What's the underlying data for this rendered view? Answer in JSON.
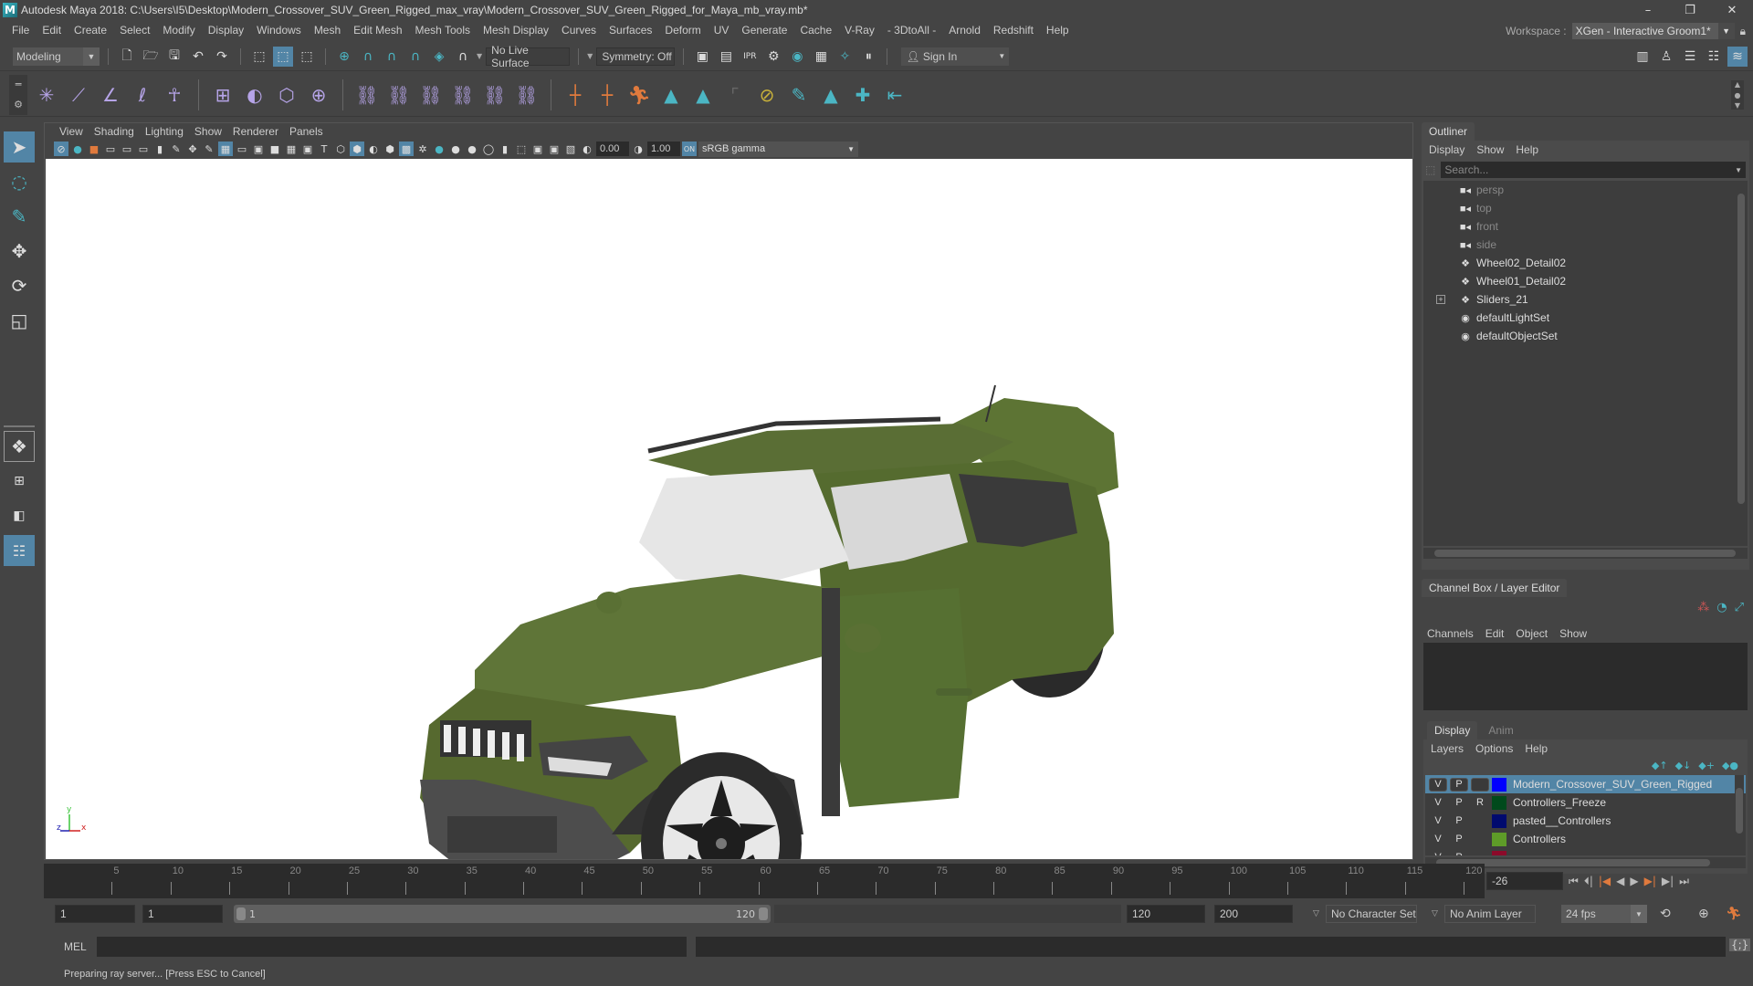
{
  "window": {
    "title": "Autodesk Maya 2018: C:\\Users\\I5\\Desktop\\Modern_Crossover_SUV_Green_Rigged_max_vray\\Modern_Crossover_SUV_Green_Rigged_for_Maya_mb_vray.mb*",
    "minimize": "–",
    "maximize": "❐",
    "close": "✕"
  },
  "menubar": {
    "items": [
      "File",
      "Edit",
      "Create",
      "Select",
      "Modify",
      "Display",
      "Windows",
      "Mesh",
      "Edit Mesh",
      "Mesh Tools",
      "Mesh Display",
      "Curves",
      "Surfaces",
      "Deform",
      "UV",
      "Generate",
      "Cache",
      "V-Ray",
      "- 3DtoAll -",
      "Arnold",
      "Redshift",
      "Help"
    ],
    "workspace_label": "Workspace :",
    "workspace_value": "XGen - Interactive Groom1*"
  },
  "statusline": {
    "mode": "Modeling",
    "live_surface": "No Live Surface",
    "symmetry": "Symmetry: Off",
    "sign_in": "Sign In"
  },
  "viewport": {
    "menu": [
      "View",
      "Shading",
      "Lighting",
      "Show",
      "Renderer",
      "Panels"
    ],
    "exposure": "0.00",
    "gamma": "1.00",
    "color_space": "sRGB gamma",
    "axis": {
      "x": "x",
      "y": "y",
      "z": "z"
    },
    "model_description": "Green modern crossover SUV with doors and tailgate open"
  },
  "outliner": {
    "title": "Outliner",
    "menu": [
      "Display",
      "Show",
      "Help"
    ],
    "search_placeholder": "Search...",
    "items": [
      {
        "label": "persp",
        "icon": "camera-icon",
        "dim": true
      },
      {
        "label": "top",
        "icon": "camera-icon",
        "dim": true
      },
      {
        "label": "front",
        "icon": "camera-icon",
        "dim": true
      },
      {
        "label": "side",
        "icon": "camera-icon",
        "dim": true
      },
      {
        "label": "Wheel02_Detail02",
        "icon": "transform-icon",
        "dim": false
      },
      {
        "label": "Wheel01_Detail02",
        "icon": "transform-icon",
        "dim": false
      },
      {
        "label": "Sliders_21",
        "icon": "transform-icon",
        "dim": false,
        "expandable": true
      },
      {
        "label": "defaultLightSet",
        "icon": "set-icon",
        "dim": false
      },
      {
        "label": "defaultObjectSet",
        "icon": "set-icon",
        "dim": false
      }
    ]
  },
  "channelbox": {
    "title": "Channel Box / Layer Editor",
    "menu": [
      "Channels",
      "Edit",
      "Object",
      "Show"
    ],
    "layer_tabs": [
      "Display",
      "Anim"
    ],
    "layer_menu": [
      "Layers",
      "Options",
      "Help"
    ],
    "layers": [
      {
        "v": "V",
        "p": "P",
        "r": "",
        "name": "Modern_Crossover_SUV_Green_Rigged",
        "color": "#0000ff",
        "selected": true
      },
      {
        "v": "V",
        "p": "P",
        "r": "R",
        "name": "Controllers_Freeze",
        "color": "#004a1c",
        "selected": false
      },
      {
        "v": "V",
        "p": "P",
        "r": "",
        "name": "pasted__Controllers",
        "color": "#000a6e",
        "selected": false
      },
      {
        "v": "V",
        "p": "P",
        "r": "",
        "name": "Controllers",
        "color": "#5e9c28",
        "selected": false
      },
      {
        "v": "V",
        "p": "P",
        "r": "",
        "name": "",
        "color": "#8c0a2a",
        "selected": false
      }
    ]
  },
  "timeline": {
    "ticks": [
      5,
      10,
      15,
      20,
      25,
      30,
      35,
      40,
      45,
      50,
      55,
      60,
      65,
      70,
      75,
      80,
      85,
      90,
      95,
      100,
      105,
      110,
      115,
      120
    ],
    "current_frame": "-26",
    "start_frame": "1",
    "playback_start": "1",
    "range_start_label": "1",
    "range_end_label": "120",
    "playback_end": "120",
    "end_frame": "200",
    "character_set": "No Character Set",
    "anim_layer": "No Anim Layer",
    "fps": "24 fps"
  },
  "cmdline": {
    "label": "MEL"
  },
  "helpline": {
    "text": "Preparing ray server... [Press ESC to Cancel]"
  }
}
